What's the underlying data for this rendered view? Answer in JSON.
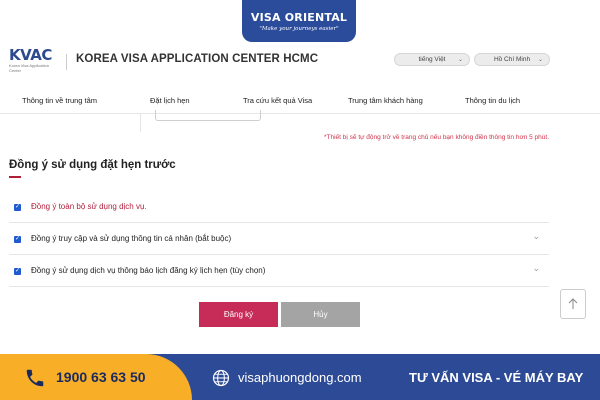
{
  "brand": {
    "name": "VISA ORIENTAL",
    "tagline": "\"Make your journeys easier\""
  },
  "header": {
    "logo_text": "KVAC",
    "logo_subtext": "Korea Visa Application Center",
    "center_title": "KOREA VISA APPLICATION CENTER HCMC",
    "language": "tiếng Việt",
    "city": "Hồ Chí Minh"
  },
  "nav": {
    "items": [
      "Thông tin về trung tâm",
      "Đặt lịch hẹn",
      "Tra cứu kết quả Visa",
      "Trung tâm khách hàng",
      "Thông tin du lịch"
    ]
  },
  "notice": "*Thiết bị sẽ tự động trở về trang chủ nếu bạn không điền thông tin hơn 5 phút.",
  "consent": {
    "title": "Đồng ý sử dụng đặt hẹn trước",
    "items": [
      {
        "label": "Đồng ý toàn bộ sử dụng dịch vụ.",
        "checked": true
      },
      {
        "label": "Đồng ý truy cập và sử dụng thông tin cá nhân (bắt buộc)",
        "checked": true
      },
      {
        "label": "Đồng ý sử dụng dịch vụ thông báo lịch đăng ký lịch hẹn (tùy chọn)",
        "checked": true
      }
    ]
  },
  "buttons": {
    "register": "Đăng ký",
    "cancel": "Hủy"
  },
  "footer": {
    "phone": "1900 63 63 50",
    "website": "visaphuongdong.com",
    "tagline": "TƯ VẤN VISA - VÉ MÁY BAY"
  },
  "colors": {
    "brand_blue": "#2b4b9b",
    "accent_red": "#b01f3a",
    "register_pink": "#c72b58",
    "cancel_gray": "#a4a4a4",
    "footer_yellow": "#f8ae26",
    "checkbox_blue": "#1e5bd3"
  },
  "icons": [
    "phone-icon",
    "globe-icon",
    "arrow-up-icon",
    "chevron-down-icon",
    "checkbox-checked-icon"
  ]
}
